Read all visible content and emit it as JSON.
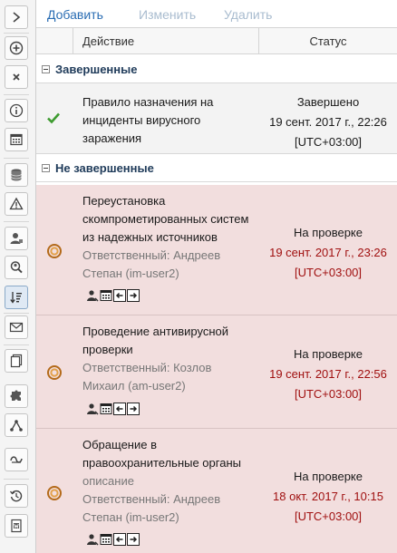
{
  "toolbar": {
    "add": "Добавить",
    "edit": "Изменить",
    "delete": "Удалить"
  },
  "table": {
    "col_action": "Действие",
    "col_status": "Статус"
  },
  "groups": {
    "completed": {
      "title": "Завершенные",
      "rows": [
        {
          "title_lines": [
            "Правило назначения на",
            "инциденты вирусного",
            "заражения"
          ],
          "status": "Завершено",
          "date": "19 сент. 2017 г., 22:26",
          "tz": "[UTC+03:00]"
        }
      ]
    },
    "pending": {
      "title": "Не завершенные",
      "rows": [
        {
          "title_lines": [
            "Переустановка",
            "скомпрометированных систем",
            "из надежных источников"
          ],
          "sub_lines": [
            "Ответственный: Андреев",
            "Степан (im-user2)"
          ],
          "status": "На проверке",
          "date": "19 сент. 2017 г., 23:26",
          "tz": "[UTC+03:00]"
        },
        {
          "title_lines": [
            "Проведение антивирусной",
            "проверки"
          ],
          "sub_lines": [
            "Ответственный: Козлов",
            "Михаил (am-user2)"
          ],
          "status": "На проверке",
          "date": "19 сент. 2017 г., 22:56",
          "tz": "[UTC+03:00]"
        },
        {
          "title_lines": [
            "Обращение в",
            "правоохранительные органы"
          ],
          "sub_lines": [
            "описание",
            "Ответственный: Андреев",
            "Степан (im-user2)"
          ],
          "status": "На проверке",
          "date": "18 окт. 2017 г., 10:15",
          "tz": "[UTC+03:00]"
        }
      ]
    }
  },
  "sidebar_icons": [
    "chevron-right-icon",
    "add-circle-icon",
    "close-icon",
    "info-icon",
    "calendar-icon",
    "database-icon",
    "warning-icon",
    "user-icon",
    "search-user-icon",
    "sort-icon",
    "mail-icon",
    "copy-icon",
    "puzzle-icon",
    "share-icon",
    "link-icon",
    "history-icon",
    "word-doc-icon"
  ],
  "colors": {
    "link": "#2a6db3",
    "link_disabled": "#a9bccf",
    "pending_row_bg": "#f2dede",
    "pending_date": "#a01010",
    "done_check": "#3d9b2f"
  }
}
